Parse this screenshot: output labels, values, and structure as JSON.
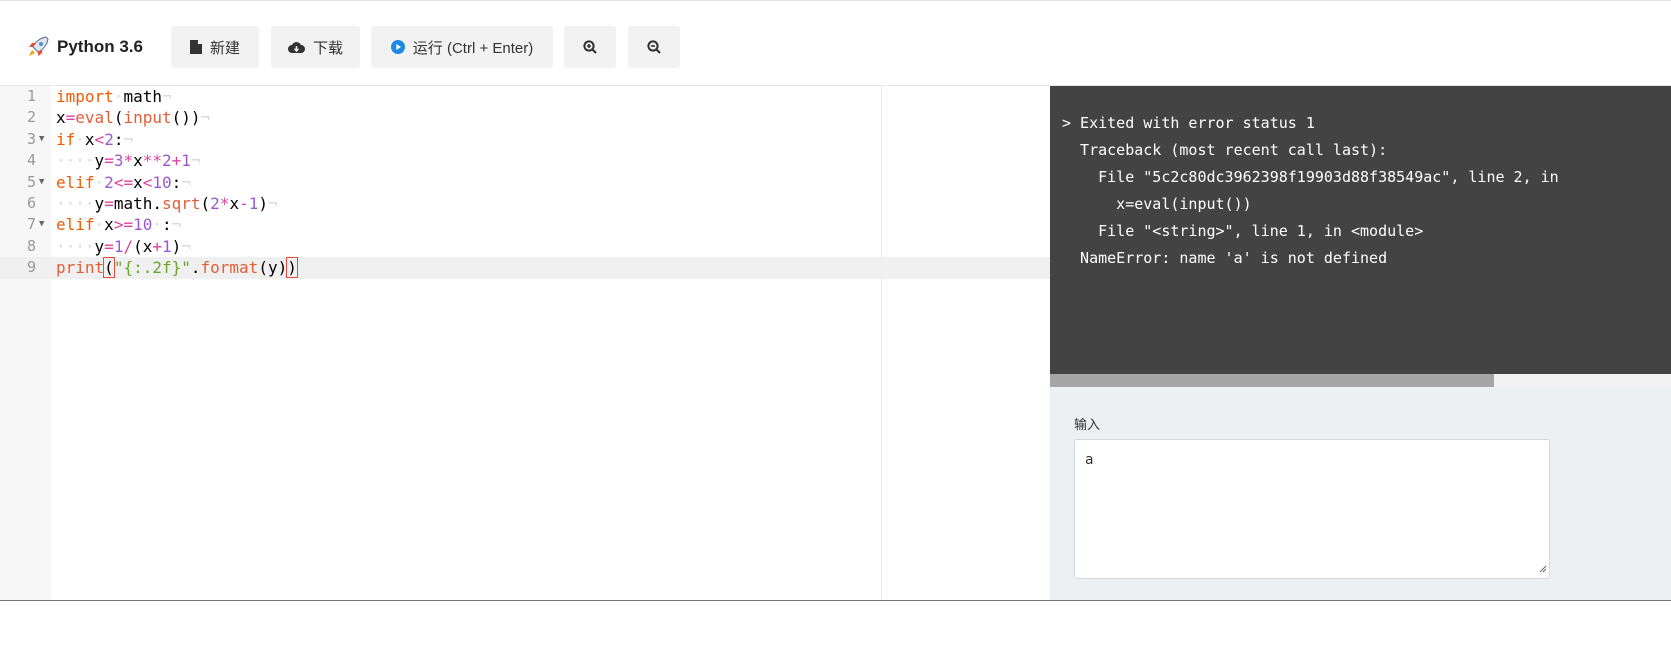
{
  "toolbar": {
    "title": "Python 3.6",
    "new_label": "新建",
    "download_label": "下载",
    "run_label": "运行 (Ctrl + Enter)"
  },
  "editor": {
    "line_numbers": [
      "1",
      "2",
      "3",
      "4",
      "5",
      "6",
      "7",
      "8",
      "9"
    ]
  },
  "console": {
    "lines": [
      "> Exited with error status 1",
      "  Traceback (most recent call last):",
      "    File \"5c2c80dc3962398f19903d88f38549ac\", line 2, in",
      "      x=eval(input())",
      "    File \"<string>\", line 1, in <module>",
      "  NameError: name 'a' is not defined"
    ]
  },
  "input": {
    "label": "输入",
    "value": "a"
  },
  "colors": {
    "keyword": "#f05a00",
    "number": "#9b59d0",
    "string": "#6aa52a",
    "console_bg": "#434343",
    "run_icon": "#1e88e5"
  }
}
